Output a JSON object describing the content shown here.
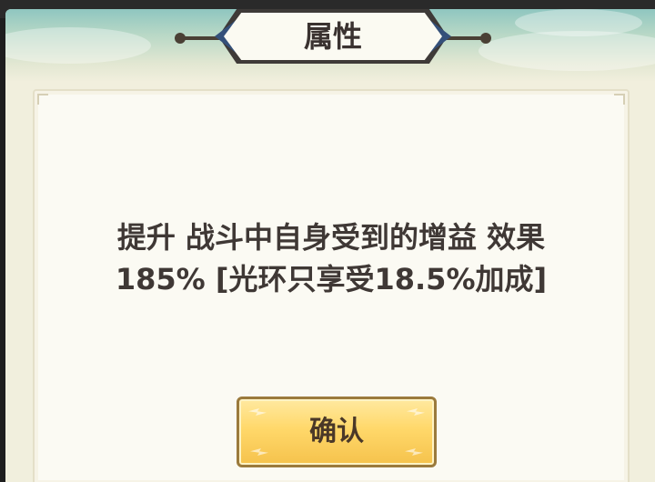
{
  "dialog": {
    "title": "属性",
    "description_line1": "提升 战斗中自身受到的增益 效果",
    "description_line2": "185% [光环只享受18.5%加成]",
    "confirm_label": "确认"
  }
}
